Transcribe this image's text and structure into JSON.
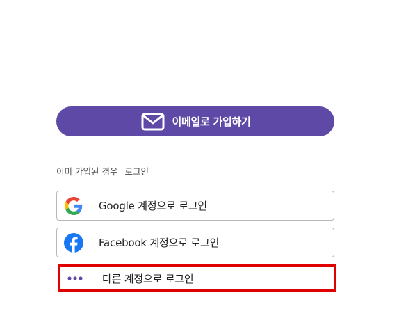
{
  "signup": {
    "email_button_label": "이메일로 가입하기"
  },
  "login_prompt": {
    "text": "이미 가입된 경우",
    "link_label": "로그인"
  },
  "social_buttons": [
    {
      "label": "Google 계정으로 로그인",
      "icon": "google-icon"
    },
    {
      "label": "Facebook 계정으로 로그인",
      "icon": "facebook-icon"
    },
    {
      "label": "다른 계정으로 로그인",
      "icon": "more-dots-icon"
    }
  ],
  "colors": {
    "primary": "#5e4aa6",
    "facebook": "#1877f2",
    "highlight_border": "#e00000"
  }
}
